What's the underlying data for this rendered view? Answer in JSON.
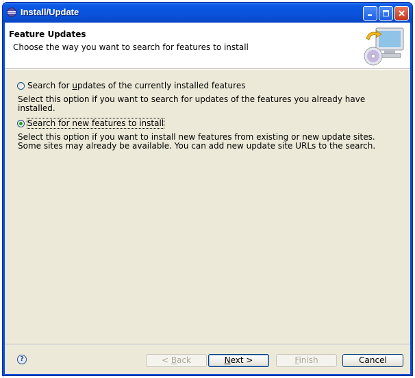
{
  "window": {
    "title": "Install/Update"
  },
  "banner": {
    "title": "Feature Updates",
    "description": "Choose the way you want to search for features to install"
  },
  "options": [
    {
      "label_pre": "Search for ",
      "label_mnemonic": "u",
      "label_post": "pdates of the currently installed features",
      "description": "Select this option if you want to search for updates of the features you already have installed.",
      "selected": false
    },
    {
      "label": "Search for new features to install",
      "description": "Select this option if you want to install new features from existing or new update sites. Some sites may already be available. You can add new update site URLs to the search.",
      "selected": true
    }
  ],
  "buttons": {
    "back_mnemonic": "B",
    "back_rest": "ack",
    "back_prefix": "< ",
    "next_mnemonic": "N",
    "next_rest": "ext",
    "next_suffix": " >",
    "finish_mnemonic": "F",
    "finish_rest": "inish",
    "cancel": "Cancel",
    "help": "?"
  },
  "colors": {
    "titlebar": "#0a52db",
    "dialog_bg": "#ece9d8",
    "radio_dot": "#21a121"
  }
}
